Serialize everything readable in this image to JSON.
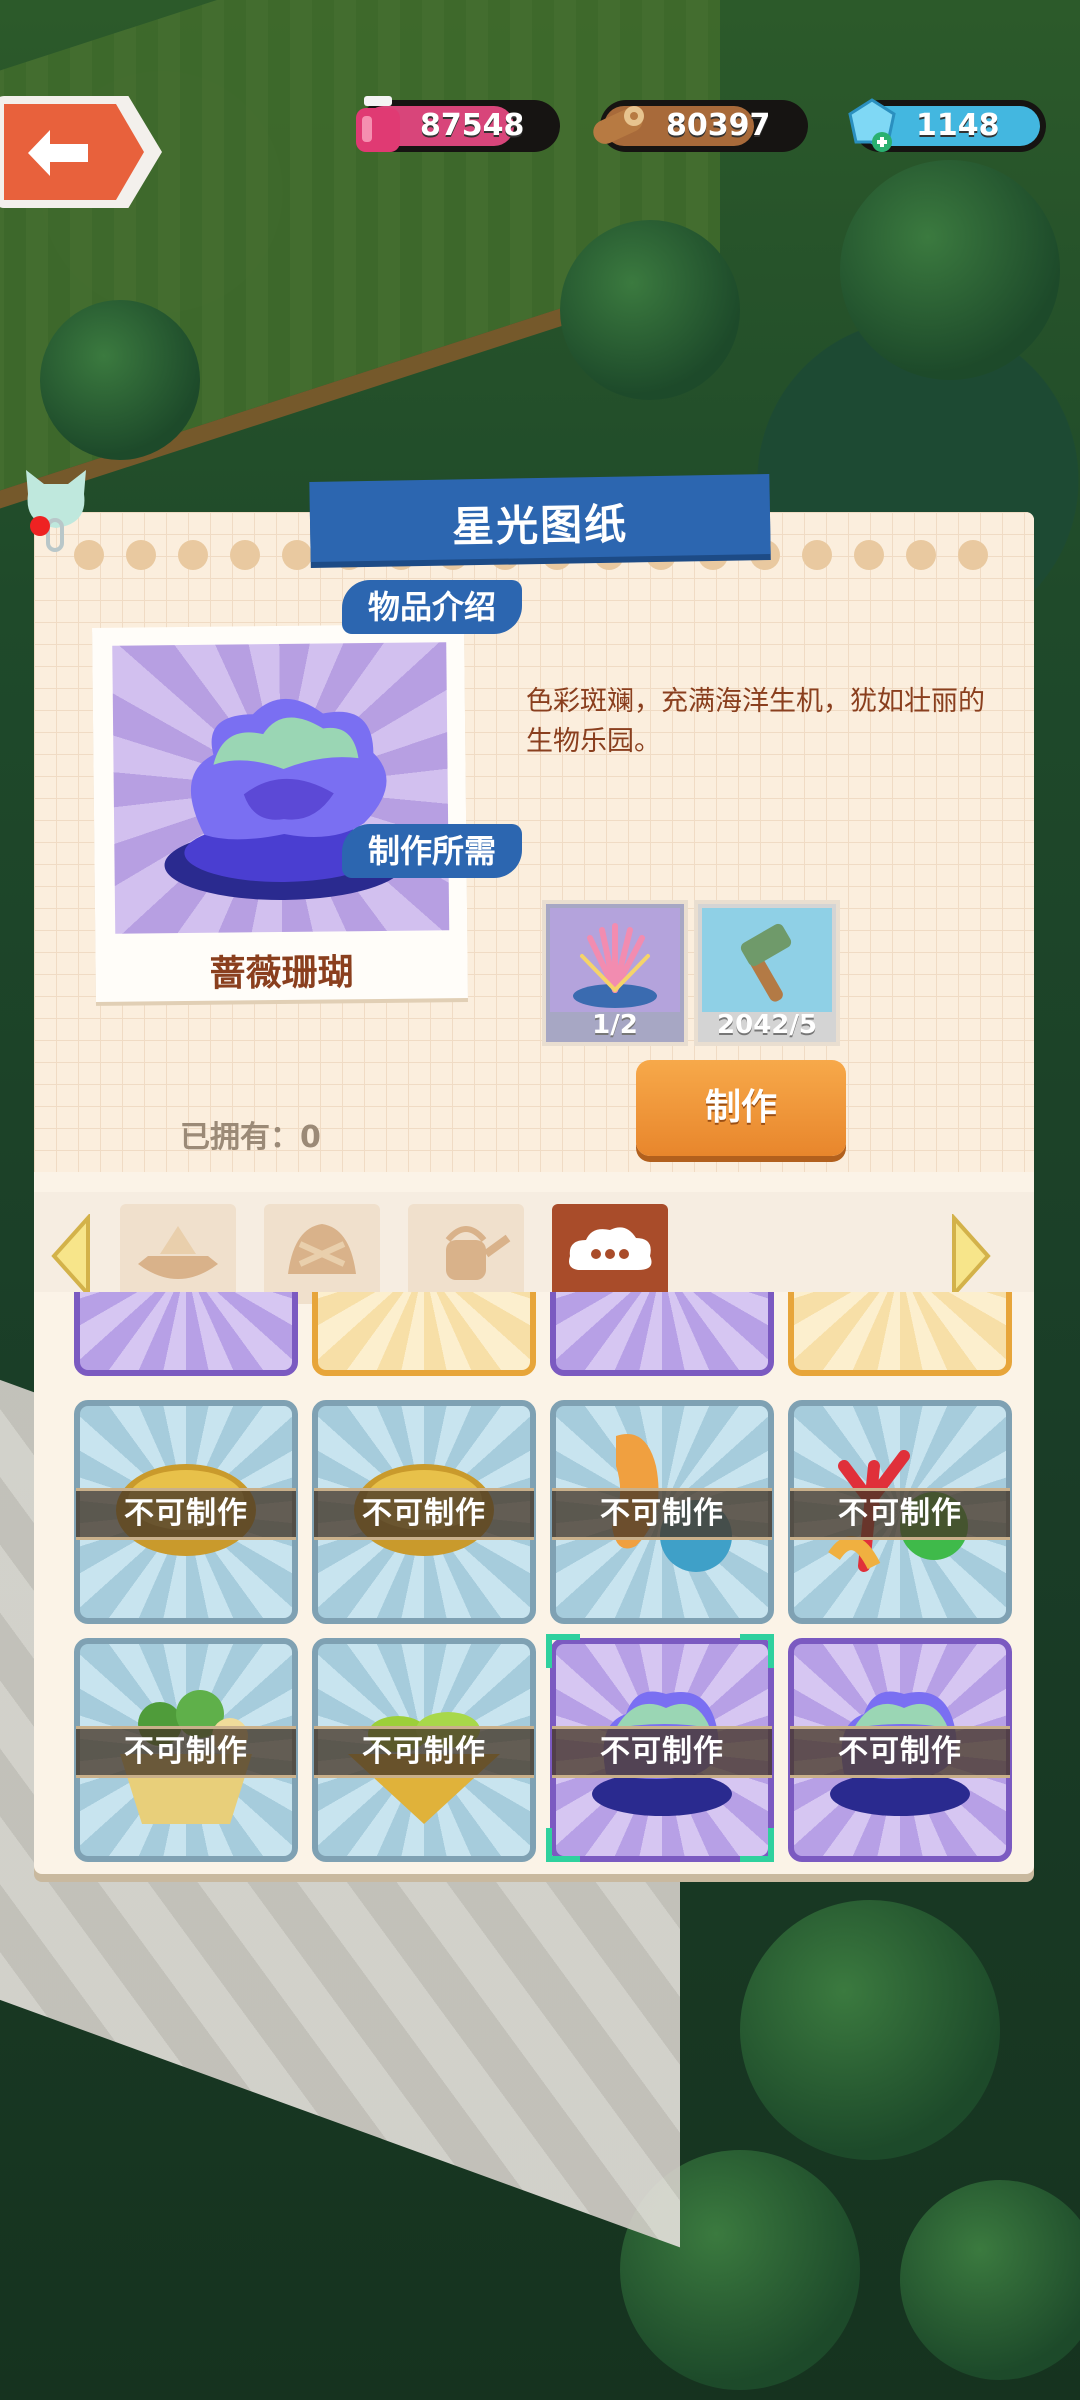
{
  "resources": {
    "ink": "87548",
    "wood": "80397",
    "gem": "1148"
  },
  "panel": {
    "title": "星光图纸",
    "item_name": "蔷薇珊瑚",
    "desc_label": "物品介绍",
    "description": "色彩斑斓，充满海洋生机，犹如壮丽的生物乐园。",
    "req_label": "制作所需",
    "requirements": [
      {
        "icon": "coral-icon",
        "count": "1/2"
      },
      {
        "icon": "hammer-icon",
        "count": "2042/5"
      }
    ],
    "owned_label": "已拥有：0",
    "make_button": "制作"
  },
  "tabs": [
    "boat-icon",
    "dumpling-icon",
    "watering-can-icon",
    "cloud-chat-icon"
  ],
  "grid": {
    "locked_label": "不可制作",
    "cells": [
      {
        "icon": "blue-bowl-icon",
        "state": "locked"
      },
      {
        "icon": "gold-bowl-icon",
        "state": "locked"
      },
      {
        "icon": "coral-fish-icon",
        "state": "locked"
      },
      {
        "icon": "red-coral-icon",
        "state": "locked"
      },
      {
        "icon": "fruit-basket-icon",
        "state": "locked"
      },
      {
        "icon": "leaf-plate-icon",
        "state": "locked"
      },
      {
        "icon": "rose-coral-icon",
        "state": "locked"
      },
      {
        "icon": "rose-coral-icon",
        "state": "locked"
      }
    ]
  },
  "colors": {
    "accent_blue": "#2c66b0",
    "button_orange": "#e8862c",
    "text_brown": "#8a3f1e",
    "selection_green": "#2fd19e"
  }
}
